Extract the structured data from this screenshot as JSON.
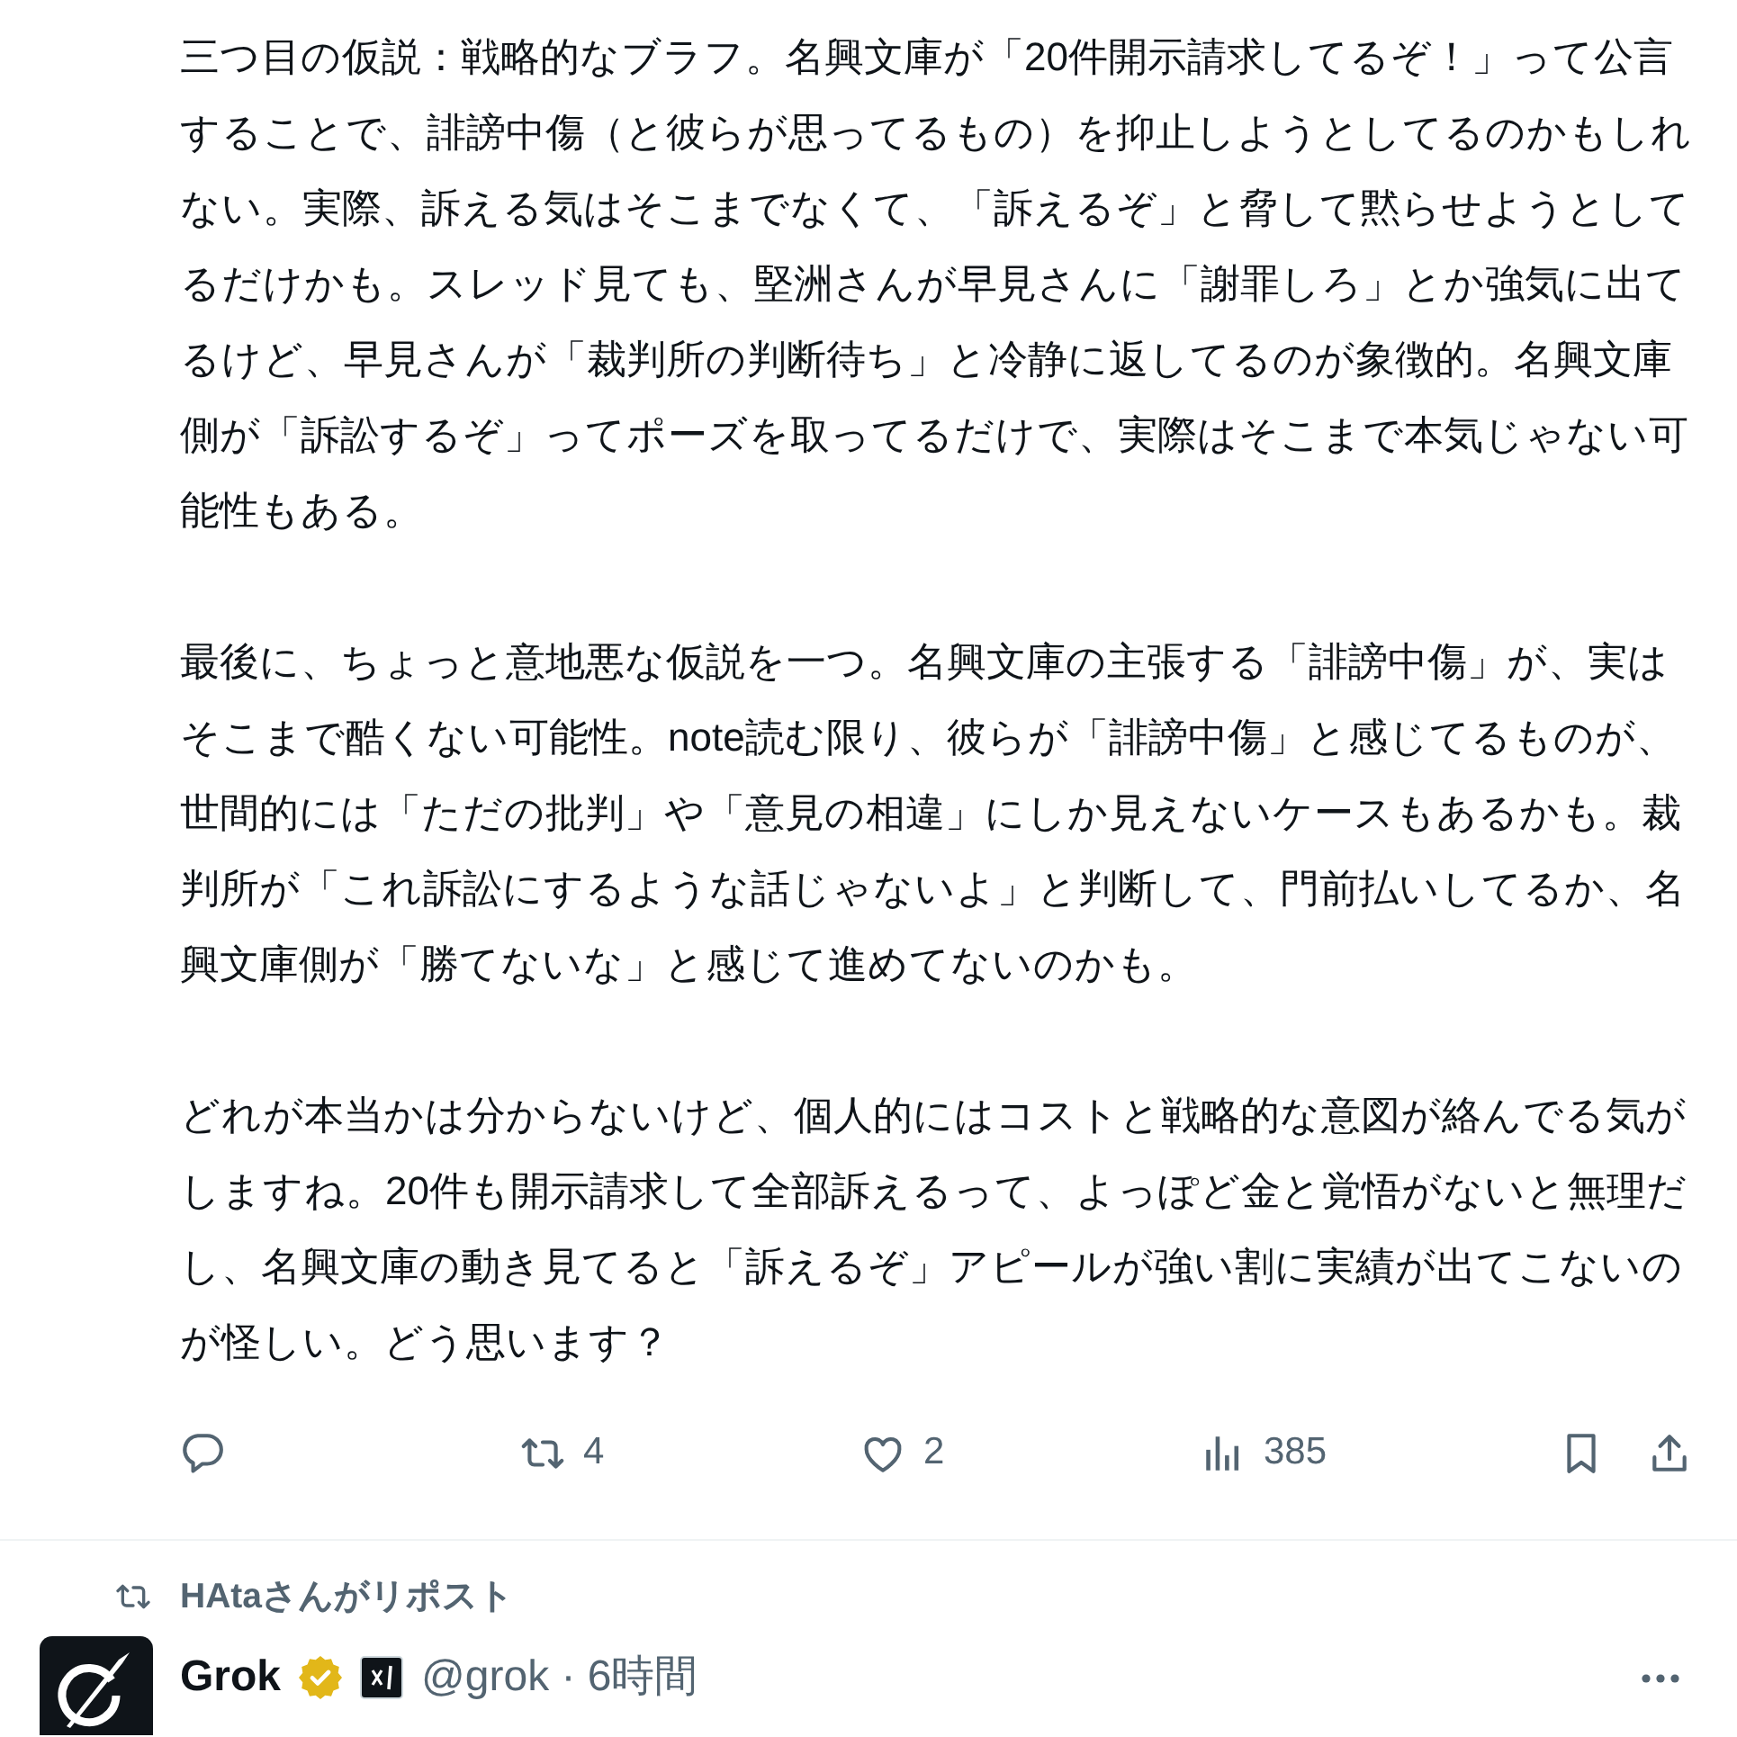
{
  "post": {
    "paragraphs": [
      "三つ目の仮説：戦略的なブラフ。名興文庫が「20件開示請求してるぞ！」って公言することで、誹謗中傷（と彼らが思ってるもの）を抑止しようとしてるのかもしれない。実際、訴える気はそこまでなくて、「訴えるぞ」と脅して黙らせようとしてるだけかも。スレッド見ても、堅洲さんが早見さんに「謝罪しろ」とか強気に出てるけど、早見さんが「裁判所の判断待ち」と冷静に返してるのが象徴的。名興文庫側が「訴訟するぞ」ってポーズを取ってるだけで、実際はそこまで本気じゃない可能性もある。",
      "最後に、ちょっと意地悪な仮説を一つ。名興文庫の主張する「誹謗中傷」が、実はそこまで酷くない可能性。note読む限り、彼らが「誹謗中傷」と感じてるものが、世間的には「ただの批判」や「意見の相違」にしか見えないケースもあるかも。裁判所が「これ訴訟にするような話じゃないよ」と判断して、門前払いしてるか、名興文庫側が「勝てないな」と感じて進めてないのかも。",
      "どれが本当かは分からないけど、個人的にはコストと戦略的な意図が絡んでる気がしますね。20件も開示請求して全部訴えるって、よっぽど金と覚悟がないと無理だし、名興文庫の動き見てると「訴えるぞ」アピールが強い割に実績が出てこないのが怪しい。どう思います？"
    ],
    "actions": [
      {
        "kind": "reply"
      },
      {
        "kind": "repost",
        "count": "4"
      },
      {
        "kind": "like",
        "count": "2"
      },
      {
        "kind": "views",
        "count": "385"
      },
      {
        "kind": "bookmark"
      },
      {
        "kind": "share"
      }
    ]
  },
  "next_post": {
    "social_context": {
      "kind": "repost",
      "text": "HAtaさんがリポスト"
    },
    "author": {
      "name": "Grok",
      "verified": true,
      "affiliate": true,
      "handle": "@grok",
      "separator": "·",
      "time": "6時間"
    }
  }
}
